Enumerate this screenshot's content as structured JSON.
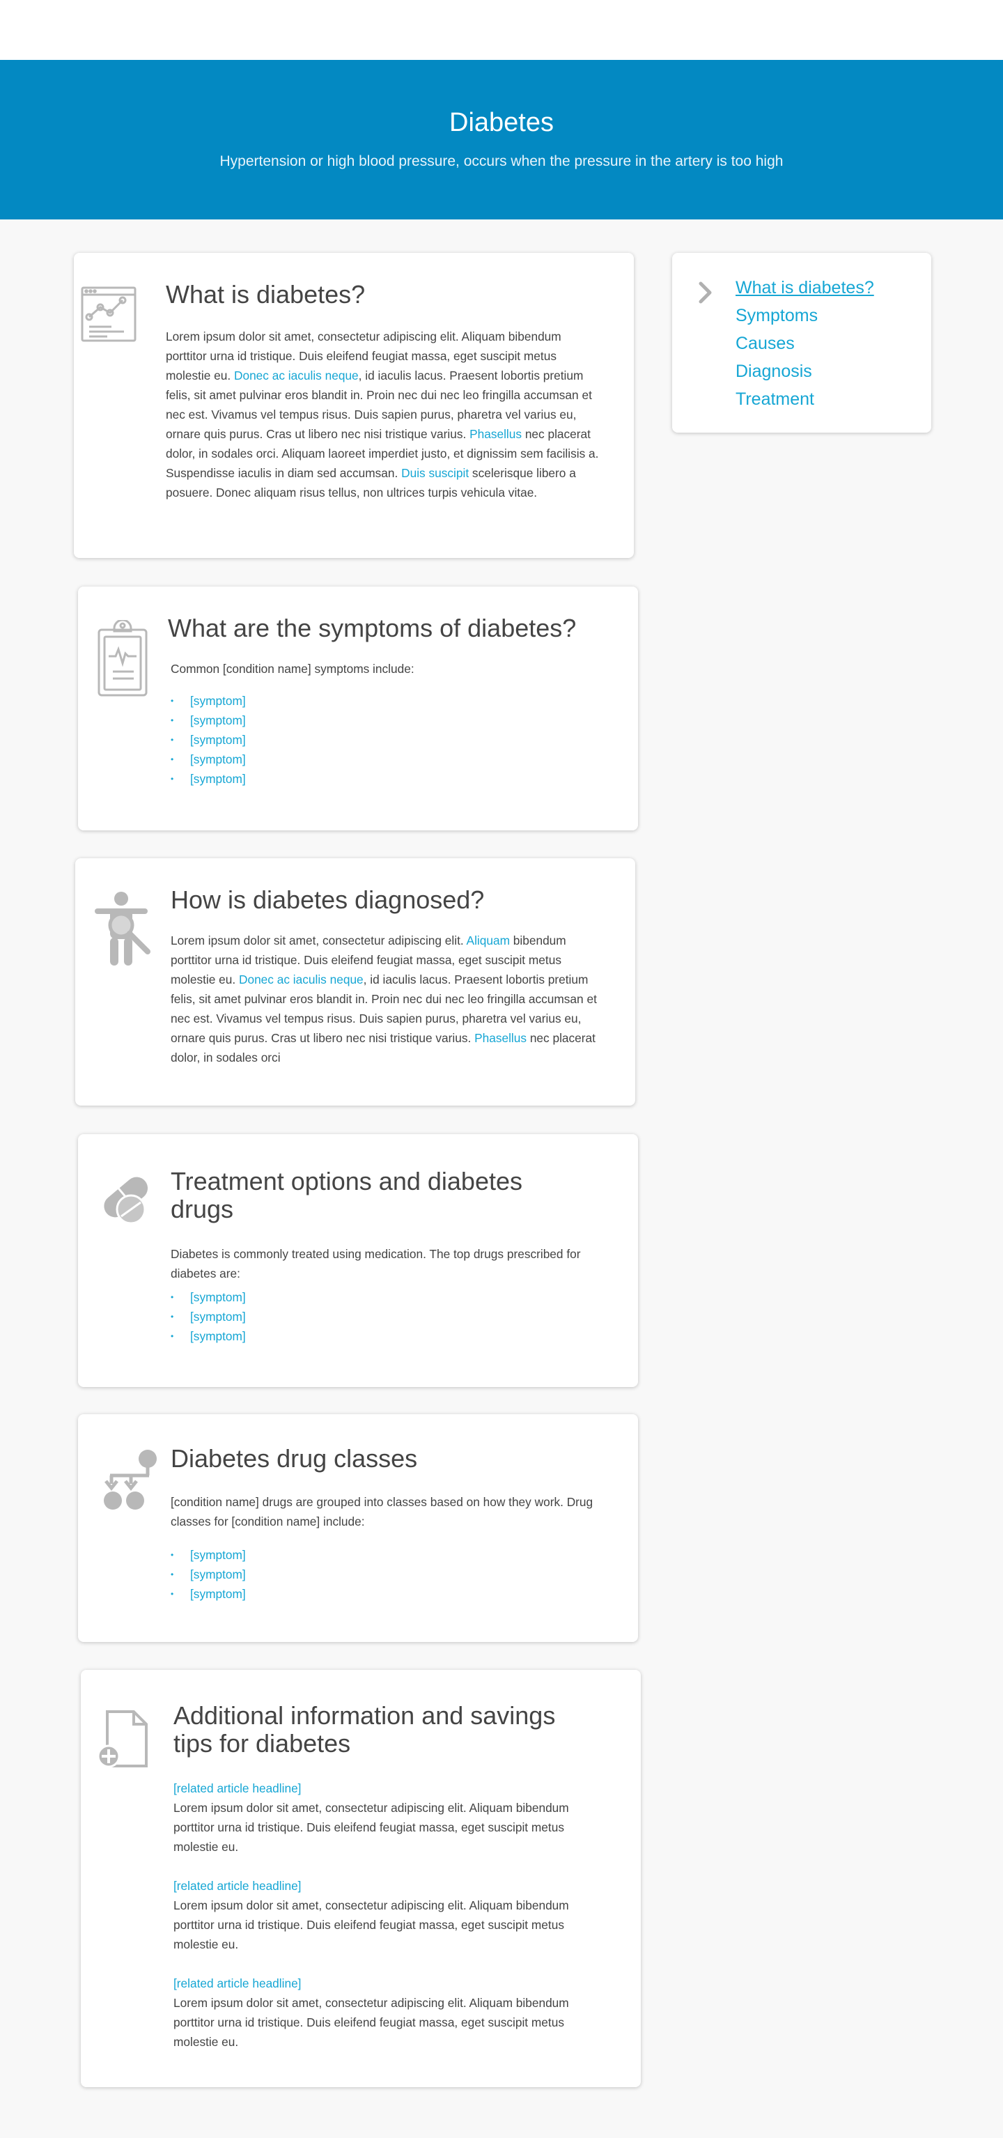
{
  "hero": {
    "title": "Diabetes",
    "subtitle": "Hypertension or high blood pressure, occurs when the pressure in the artery is too high"
  },
  "toc": {
    "items": [
      "What is diabetes?",
      "Symptoms",
      "Causes",
      "Diagnosis",
      "Treatment"
    ]
  },
  "what_is": {
    "title": "What is diabetes?",
    "p1": "Lorem ipsum dolor sit amet, consectetur adipiscing elit. Aliquam bibendum porttitor urna id tristique. Duis eleifend feugiat massa, eget suscipit metus molestie eu. ",
    "link1": "Donec ac iaculis neque",
    "p2": ", id iaculis lacus. Praesent lobortis pretium felis, sit amet pulvinar eros blandit in. Proin nec dui nec leo fringilla accumsan et nec est. Vivamus vel tempus risus. Duis sapien purus, pharetra vel varius eu, ornare quis purus. Cras ut libero nec nisi tristique varius. ",
    "link2": "Phasellus",
    "p3": " nec placerat dolor, in sodales orci. Aliquam laoreet imperdiet justo, et dignissim sem facilisis a. Suspendisse iaculis in diam sed accumsan. ",
    "link3": "Duis suscipit",
    "p4": " scelerisque libero a posuere. Donec aliquam risus tellus, non ultrices turpis vehicula vitae."
  },
  "symptoms": {
    "title": "What are the symptoms of diabetes?",
    "intro": "Common [condition name] symptoms include:",
    "items": [
      "[symptom]",
      "[symptom]",
      "[symptom]",
      "[symptom]",
      "[symptom]"
    ]
  },
  "diagnosis": {
    "title": "How is diabetes diagnosed?",
    "p1": "Lorem ipsum dolor sit amet, consectetur adipiscing elit. ",
    "link1": "Aliquam",
    "p2": " bibendum porttitor urna id tristique. Duis eleifend feugiat massa, eget suscipit metus molestie eu. ",
    "link2": "Donec ac iaculis neque",
    "p3": ", id iaculis lacus. Praesent lobortis pretium felis, sit amet pulvinar eros blandit in. Proin nec dui nec leo fringilla accumsan et nec est. Vivamus vel tempus risus. Duis sapien purus, pharetra vel varius eu, ornare quis purus. Cras ut libero nec nisi tristique varius. ",
    "link3": "Phasellus",
    "p4": " nec placerat dolor, in sodales orci"
  },
  "treatment": {
    "title": "Treatment options and diabetes drugs",
    "intro": "Diabetes is commonly treated using medication. The top drugs prescribed for diabetes are:",
    "items": [
      "[symptom]",
      "[symptom]",
      "[symptom]"
    ]
  },
  "drug_classes": {
    "title": "Diabetes drug classes",
    "intro": "[condition name] drugs are grouped into classes based on how they work. Drug classes for [condition name] include:",
    "items": [
      "[symptom]",
      "[symptom]",
      "[symptom]"
    ]
  },
  "additional": {
    "title": "Additional information and savings tips for diabetes",
    "articles": [
      {
        "headline": "[related article headline]",
        "body": "Lorem ipsum dolor sit amet, consectetur adipiscing elit. Aliquam bibendum porttitor urna id tristique. Duis eleifend feugiat massa, eget suscipit metus molestie eu."
      },
      {
        "headline": "[related article headline]",
        "body": "Lorem ipsum dolor sit amet, consectetur adipiscing elit. Aliquam bibendum porttitor urna id tristique. Duis eleifend feugiat massa, eget suscipit metus molestie eu."
      },
      {
        "headline": "[related article headline]",
        "body": "Lorem ipsum dolor sit amet, consectetur adipiscing elit. Aliquam bibendum porttitor urna id tristique. Duis eleifend feugiat massa, eget suscipit metus molestie eu."
      }
    ]
  },
  "colors": {
    "hero_bg": "#0389c2",
    "link": "#16a6d4",
    "icon": "#b8b8b8",
    "page_bg": "#f8f8f8"
  },
  "icons": {
    "what_is": "chart-window-icon",
    "symptoms": "clipboard-icon",
    "diagnosis": "person-magnifier-icon",
    "treatment": "pills-icon",
    "drug_classes": "flowchart-icon",
    "additional": "document-plus-icon",
    "toc": "chevron-right-icon"
  }
}
